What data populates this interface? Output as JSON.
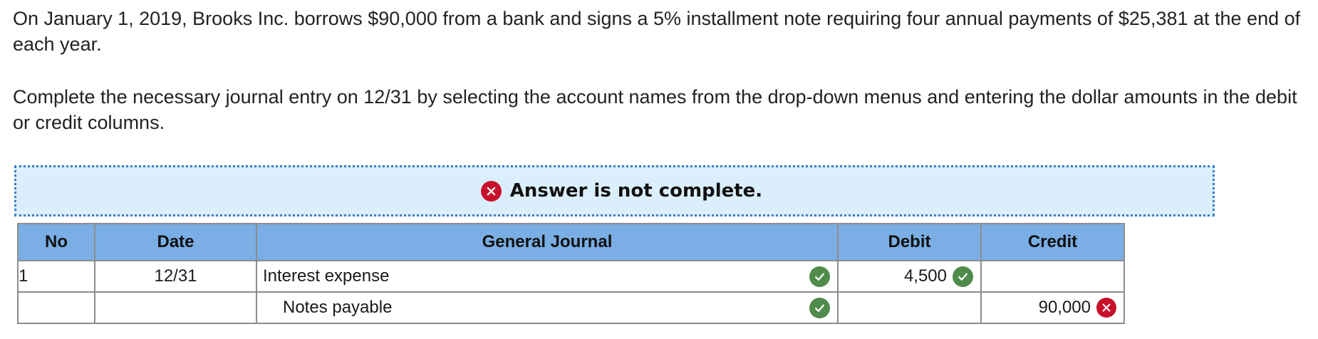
{
  "question": {
    "paragraph1": "On January 1, 2019, Brooks Inc. borrows $90,000 from a bank and signs a 5% installment note requiring four annual payments of $25,381 at the end of each year.",
    "paragraph2": "Complete the necessary journal entry on 12/31 by selecting the account names from the drop-down menus and entering the dollar amounts in the debit or credit columns."
  },
  "banner": {
    "text": "Answer is not complete.",
    "icon": "x-circle-icon",
    "color": "#c7102a"
  },
  "table": {
    "headers": {
      "no": "No",
      "date": "Date",
      "journal": "General Journal",
      "debit": "Debit",
      "credit": "Credit"
    },
    "header_color": "#7aaee4",
    "rows": [
      {
        "no": "1",
        "date": "12/31",
        "account": "Interest expense",
        "account_status": "correct",
        "debit": "4,500",
        "debit_status": "correct",
        "credit": "",
        "credit_status": ""
      },
      {
        "no": "",
        "date": "",
        "account": "Notes payable",
        "account_status": "correct",
        "debit": "",
        "debit_status": "",
        "credit": "90,000",
        "credit_status": "incorrect"
      }
    ]
  },
  "status_colors": {
    "correct": "#4f8b4a",
    "incorrect": "#c7102a"
  }
}
